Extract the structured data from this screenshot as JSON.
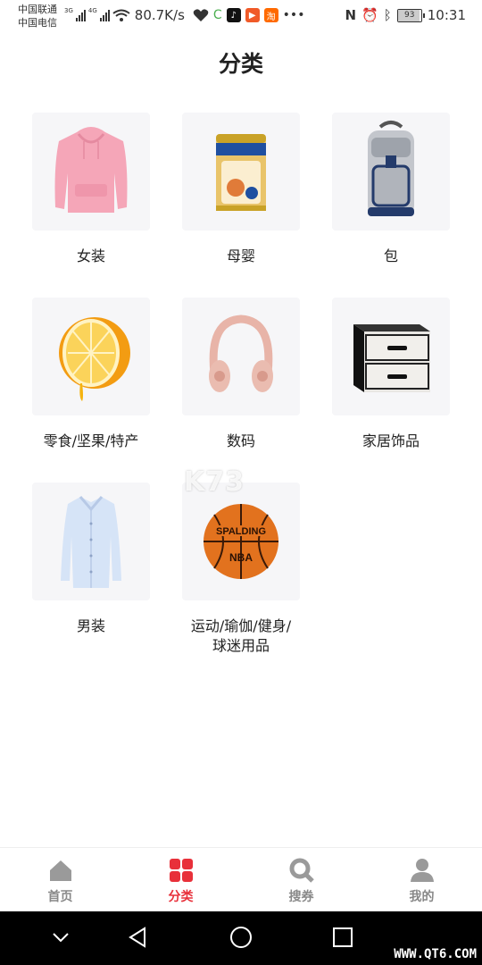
{
  "status_bar": {
    "carrier_1": "中国联通",
    "carrier_2": "中国电信",
    "net_1": "3G",
    "net_2": "4G",
    "speed": "80.7K/s",
    "battery": "93",
    "time": "10:31"
  },
  "page": {
    "title": "分类"
  },
  "categories": [
    {
      "label": "女装",
      "icon": "hoodie-image"
    },
    {
      "label": "母婴",
      "icon": "milk-powder-can-image"
    },
    {
      "label": "包",
      "icon": "backpack-image"
    },
    {
      "label": "零食/坚果/特产",
      "icon": "orange-image"
    },
    {
      "label": "数码",
      "icon": "headphones-image"
    },
    {
      "label": "家居饰品",
      "icon": "storage-box-image"
    },
    {
      "label": "男装",
      "icon": "dress-shirt-image"
    },
    {
      "label": "运动/瑜伽/健身/球迷用品",
      "icon": "basketball-image"
    }
  ],
  "watermark": "K73",
  "tabbar": {
    "items": [
      {
        "label": "首页",
        "icon": "home-icon"
      },
      {
        "label": "分类",
        "icon": "grid-icon"
      },
      {
        "label": "搜券",
        "icon": "search-icon"
      },
      {
        "label": "我的",
        "icon": "user-icon"
      }
    ],
    "active_index": 1
  },
  "site_mark": "WWW.QT6.COM",
  "colors": {
    "accent": "#e8303a",
    "inactive": "#888888",
    "tile_bg": "#f6f6f8"
  }
}
